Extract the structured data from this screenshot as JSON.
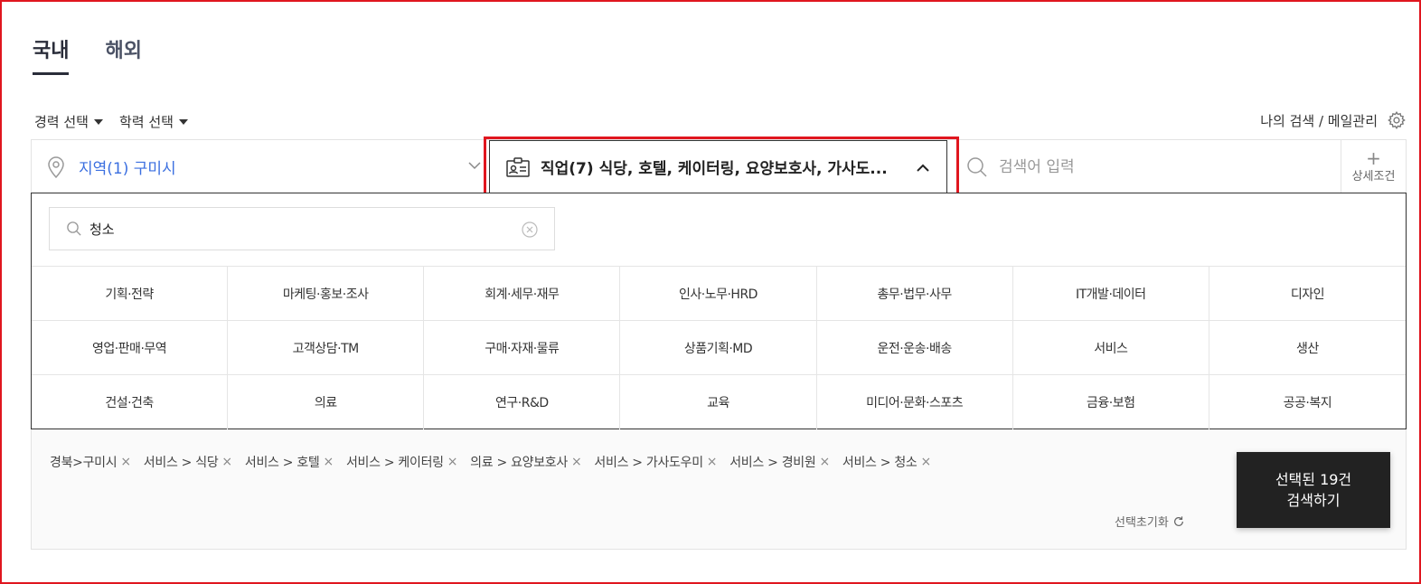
{
  "tabs": [
    {
      "label": "국내",
      "active": true
    },
    {
      "label": "해외",
      "active": false
    }
  ],
  "filters": {
    "career_label": "경력 선택",
    "education_label": "학력 선택"
  },
  "my_search_label": "나의 검색 / 메일관리",
  "searchbar": {
    "region_label": "지역(1) 구미시",
    "job_label": "직업(7) 식당, 호텔, 케이터링, 요양보호사, 가사도...",
    "keyword_placeholder": "검색어 입력",
    "detail_label": "상세조건",
    "detail_plus": "+"
  },
  "panel": {
    "search_value": "청소",
    "categories": [
      "기획·전략",
      "마케팅·홍보·조사",
      "회계·세무·재무",
      "인사·노무·HRD",
      "총무·법무·사무",
      "IT개발·데이터",
      "디자인",
      "영업·판매·무역",
      "고객상담·TM",
      "구매·자재·물류",
      "상품기획·MD",
      "운전·운송·배송",
      "서비스",
      "생산",
      "건설·건축",
      "의료",
      "연구·R&D",
      "교육",
      "미디어·문화·스포츠",
      "금융·보험",
      "공공·복지"
    ]
  },
  "selected": {
    "tags": [
      "경북>구미시",
      "서비스 > 식당",
      "서비스 > 호텔",
      "서비스 > 케이터링",
      "의료 > 요양보호사",
      "서비스 > 가사도우미",
      "서비스 > 경비원",
      "서비스 > 청소"
    ],
    "remove_glyph": "×",
    "reset_label": "선택초기화",
    "button_line1": "선택된 19건",
    "button_line2": "검색하기"
  },
  "colors": {
    "highlight": "#e0161f",
    "region_text": "#3b6fe0",
    "button_bg": "#222222"
  },
  "icons": {
    "region": "location-pin-icon",
    "job": "id-card-icon",
    "search": "search-icon",
    "settings": "gear-icon",
    "clear": "clear-circle-icon",
    "reset": "refresh-icon"
  }
}
